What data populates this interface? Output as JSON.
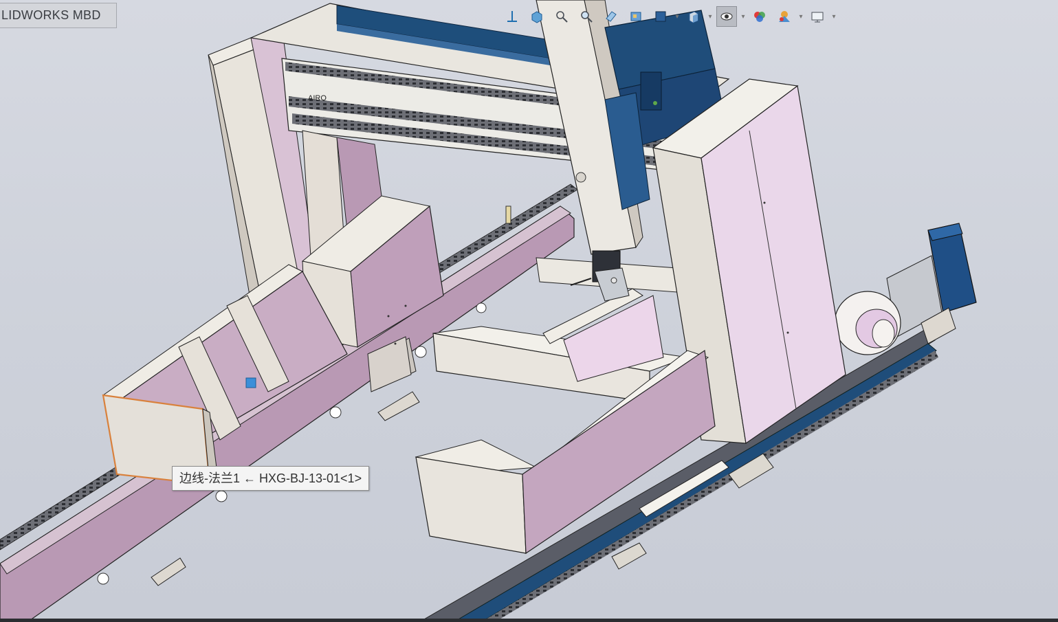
{
  "app": {
    "product_tab_label": "LIDWORKS MBD"
  },
  "toolbar": {
    "name": "heads-up-view-toolbar",
    "buttons": [
      {
        "name": "view-orientation-icon"
      },
      {
        "name": "zoom-to-fit-icon"
      },
      {
        "name": "zoom-to-area-icon"
      },
      {
        "name": "previous-view-icon"
      },
      {
        "name": "section-view-icon"
      },
      {
        "name": "dynamic-annotation-icon"
      },
      {
        "name": "view-orientation-dropdown-icon"
      },
      {
        "name": "display-style-icon"
      },
      {
        "name": "hide-show-items-icon"
      },
      {
        "name": "edit-appearance-icon"
      },
      {
        "name": "apply-scene-icon"
      },
      {
        "name": "view-settings-icon"
      }
    ]
  },
  "selection_tooltip": {
    "text": "边线-法兰1 ← HXG-BJ-13-01<1>"
  },
  "colors": {
    "viewport_bg": "#cfd3dc",
    "part_beige": "#e8e4dc",
    "part_lilac": "#c9a9c3",
    "part_pink": "#ead9ea",
    "rail_navy": "#1f4d7a",
    "rail_dark": "#3b3f49",
    "selection_orange": "#d9813c",
    "selection_blue": "#3a8fd9"
  }
}
